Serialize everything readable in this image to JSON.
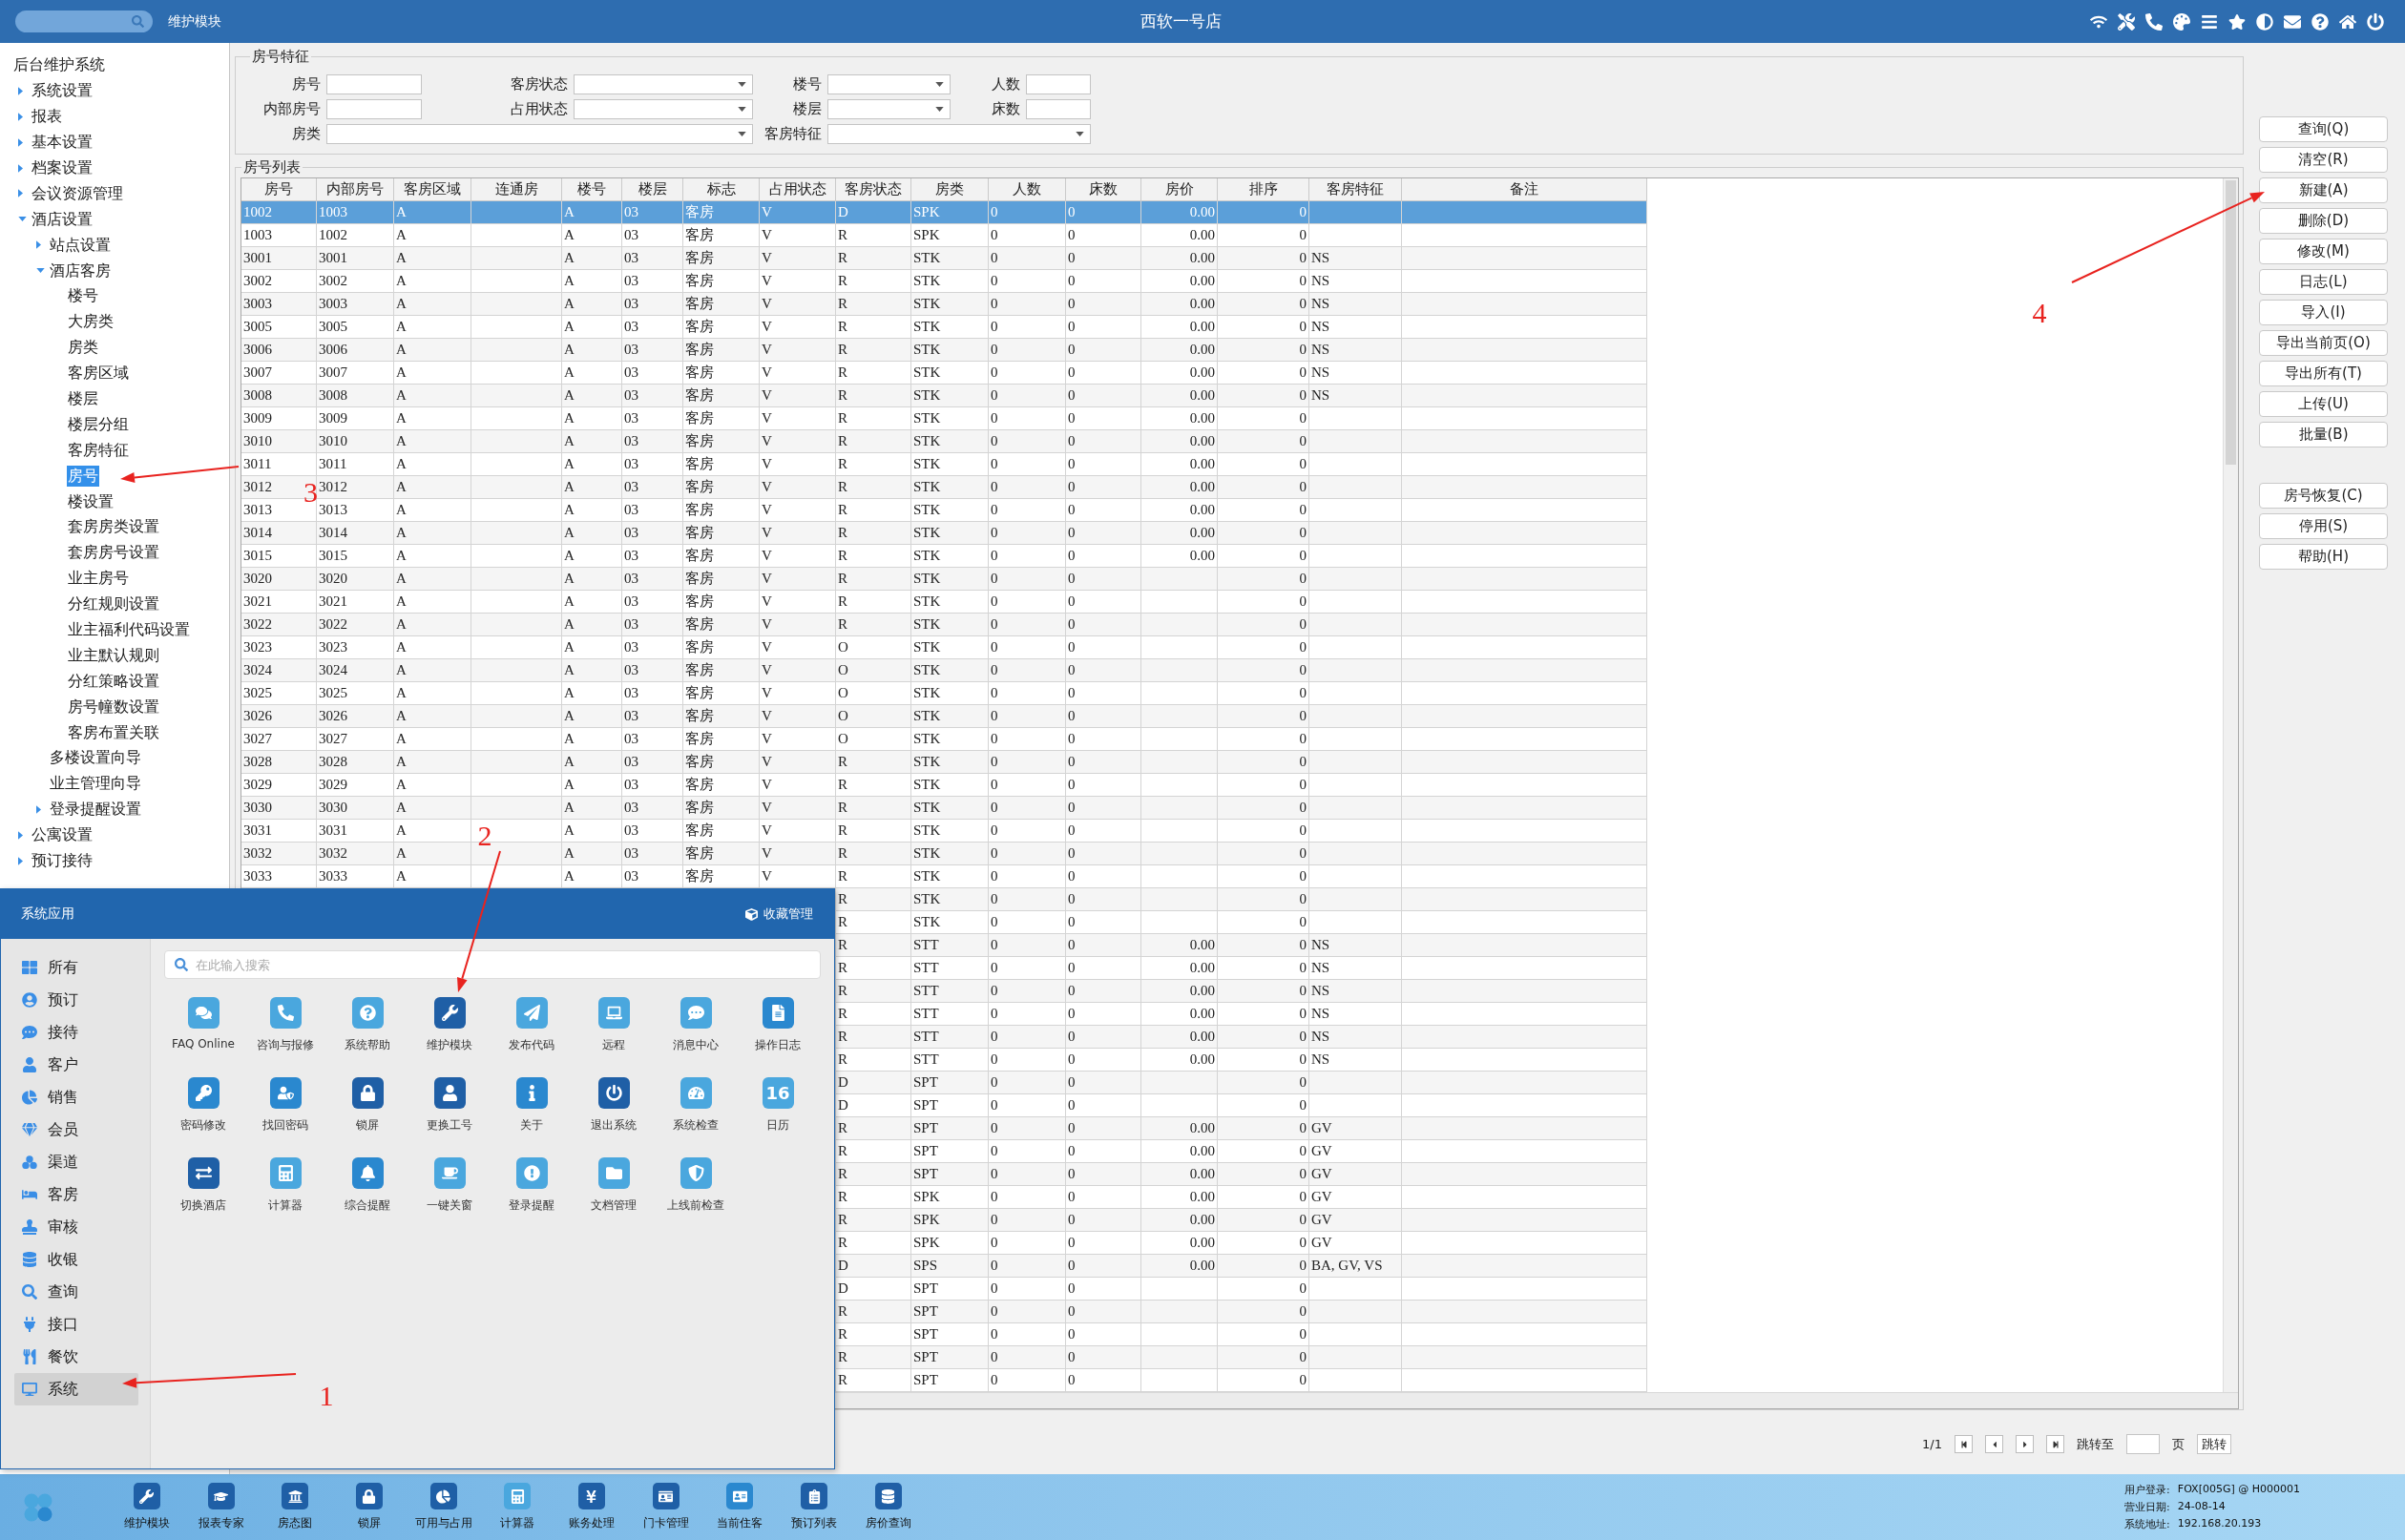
{
  "window": {
    "title": "西软一号店",
    "module": "维护模块"
  },
  "tree": [
    {
      "label": "后台维护系统",
      "selected": false,
      "children": [
        {
          "label": "系统设置",
          "expanded": false,
          "selected": false
        },
        {
          "label": "报表",
          "expanded": false,
          "selected": false
        },
        {
          "label": "基本设置",
          "expanded": false,
          "selected": false
        },
        {
          "label": "档案设置",
          "expanded": false,
          "selected": false
        },
        {
          "label": "会议资源管理",
          "expanded": false,
          "selected": false
        },
        {
          "label": "酒店设置",
          "expanded": true,
          "selected": false,
          "children": [
            {
              "label": "站点设置",
              "expanded": false,
              "selected": false
            },
            {
              "label": "酒店客房",
              "expanded": true,
              "selected": false,
              "children": [
                {
                  "label": "楼号",
                  "selected": false
                },
                {
                  "label": "大房类",
                  "selected": false
                },
                {
                  "label": "房类",
                  "selected": false
                },
                {
                  "label": "客房区域",
                  "selected": false
                },
                {
                  "label": "楼层",
                  "selected": false
                },
                {
                  "label": "楼层分组",
                  "selected": false
                },
                {
                  "label": "客房特征",
                  "selected": false
                },
                {
                  "label": "房号",
                  "selected": true
                },
                {
                  "label": "楼设置",
                  "selected": false
                },
                {
                  "label": "套房房类设置",
                  "selected": false
                },
                {
                  "label": "套房房号设置",
                  "selected": false
                },
                {
                  "label": "业主房号",
                  "selected": false
                },
                {
                  "label": "分红规则设置",
                  "selected": false
                },
                {
                  "label": "业主福利代码设置",
                  "selected": false
                },
                {
                  "label": "业主默认规则",
                  "selected": false
                },
                {
                  "label": "分红策略设置",
                  "selected": false
                },
                {
                  "label": "房号幢数设置",
                  "selected": false
                },
                {
                  "label": "客房布置关联",
                  "selected": false
                }
              ]
            },
            {
              "label": "多楼设置向导",
              "selected": false
            },
            {
              "label": "业主管理向导",
              "selected": false
            },
            {
              "label": "登录提醒设置",
              "expanded": false,
              "selected": false
            }
          ]
        },
        {
          "label": "公寓设置",
          "expanded": false,
          "selected": false
        },
        {
          "label": "预订接待",
          "expanded": false,
          "selected": false
        }
      ]
    }
  ],
  "filter": {
    "title": "房号特征",
    "rows": [
      {
        "fields": [
          {
            "label": "房号",
            "kind": "input"
          },
          {
            "label": "客房状态",
            "kind": "select"
          },
          {
            "label": "楼号",
            "kind": "select"
          },
          {
            "label": "人数",
            "kind": "input"
          }
        ]
      },
      {
        "fields": [
          {
            "label": "内部房号",
            "kind": "input"
          },
          {
            "label": "占用状态",
            "kind": "select"
          },
          {
            "label": "楼层",
            "kind": "select"
          },
          {
            "label": "床数",
            "kind": "input"
          }
        ]
      },
      {
        "fields": [
          {
            "label": "房类",
            "kind": "select"
          },
          {
            "label": "客房特征",
            "kind": "select"
          }
        ]
      }
    ]
  },
  "table": {
    "title": "房号列表",
    "columns": [
      "房号",
      "内部房号",
      "客房区域",
      "连通房",
      "楼号",
      "楼层",
      "标志",
      "占用状态",
      "客房状态",
      "房类",
      "人数",
      "床数",
      "房价",
      "排序",
      "客房特征",
      "备注"
    ],
    "rows": [
      {
        "selected": true,
        "room": "1002",
        "internal": "1003",
        "area": "A",
        "building": "A",
        "floor": "03",
        "flag": "客房",
        "occupancy": "V",
        "status": "D",
        "type": "SPK",
        "persons": "0",
        "beds": "0",
        "price": "0.00",
        "sort": "0"
      },
      {
        "selected": false,
        "room": "1003",
        "internal": "1002",
        "area": "A",
        "building": "A",
        "floor": "03",
        "flag": "客房",
        "occupancy": "V",
        "status": "R",
        "type": "SPK",
        "persons": "0",
        "beds": "0",
        "price": "0.00",
        "sort": "0"
      },
      {
        "selected": false,
        "room": "3001",
        "internal": "3001",
        "area": "A",
        "building": "A",
        "floor": "03",
        "flag": "客房",
        "occupancy": "V",
        "status": "R",
        "type": "STK",
        "persons": "0",
        "beds": "0",
        "price": "0.00",
        "sort": "0",
        "features": "NS"
      },
      {
        "selected": false,
        "room": "3002",
        "internal": "3002",
        "area": "A",
        "building": "A",
        "floor": "03",
        "flag": "客房",
        "occupancy": "V",
        "status": "R",
        "type": "STK",
        "persons": "0",
        "beds": "0",
        "price": "0.00",
        "sort": "0",
        "features": "NS"
      },
      {
        "selected": false,
        "room": "3003",
        "internal": "3003",
        "area": "A",
        "building": "A",
        "floor": "03",
        "flag": "客房",
        "occupancy": "V",
        "status": "R",
        "type": "STK",
        "persons": "0",
        "beds": "0",
        "price": "0.00",
        "sort": "0",
        "features": "NS"
      },
      {
        "selected": false,
        "room": "3005",
        "internal": "3005",
        "area": "A",
        "building": "A",
        "floor": "03",
        "flag": "客房",
        "occupancy": "V",
        "status": "R",
        "type": "STK",
        "persons": "0",
        "beds": "0",
        "price": "0.00",
        "sort": "0",
        "features": "NS"
      },
      {
        "selected": false,
        "room": "3006",
        "internal": "3006",
        "area": "A",
        "building": "A",
        "floor": "03",
        "flag": "客房",
        "occupancy": "V",
        "status": "R",
        "type": "STK",
        "persons": "0",
        "beds": "0",
        "price": "0.00",
        "sort": "0",
        "features": "NS"
      },
      {
        "selected": false,
        "room": "3007",
        "internal": "3007",
        "area": "A",
        "building": "A",
        "floor": "03",
        "flag": "客房",
        "occupancy": "V",
        "status": "R",
        "type": "STK",
        "persons": "0",
        "beds": "0",
        "price": "0.00",
        "sort": "0",
        "features": "NS"
      },
      {
        "selected": false,
        "room": "3008",
        "internal": "3008",
        "area": "A",
        "building": "A",
        "floor": "03",
        "flag": "客房",
        "occupancy": "V",
        "status": "R",
        "type": "STK",
        "persons": "0",
        "beds": "0",
        "price": "0.00",
        "sort": "0",
        "features": "NS"
      },
      {
        "selected": false,
        "room": "3009",
        "internal": "3009",
        "area": "A",
        "building": "A",
        "floor": "03",
        "flag": "客房",
        "occupancy": "V",
        "status": "R",
        "type": "STK",
        "persons": "0",
        "beds": "0",
        "price": "0.00",
        "sort": "0"
      },
      {
        "selected": false,
        "room": "3010",
        "internal": "3010",
        "area": "A",
        "building": "A",
        "floor": "03",
        "flag": "客房",
        "occupancy": "V",
        "status": "R",
        "type": "STK",
        "persons": "0",
        "beds": "0",
        "price": "0.00",
        "sort": "0"
      },
      {
        "selected": false,
        "room": "3011",
        "internal": "3011",
        "area": "A",
        "building": "A",
        "floor": "03",
        "flag": "客房",
        "occupancy": "V",
        "status": "R",
        "type": "STK",
        "persons": "0",
        "beds": "0",
        "price": "0.00",
        "sort": "0"
      },
      {
        "selected": false,
        "room": "3012",
        "internal": "3012",
        "area": "A",
        "building": "A",
        "floor": "03",
        "flag": "客房",
        "occupancy": "V",
        "status": "R",
        "type": "STK",
        "persons": "0",
        "beds": "0",
        "price": "0.00",
        "sort": "0"
      },
      {
        "selected": false,
        "room": "3013",
        "internal": "3013",
        "area": "A",
        "building": "A",
        "floor": "03",
        "flag": "客房",
        "occupancy": "V",
        "status": "R",
        "type": "STK",
        "persons": "0",
        "beds": "0",
        "price": "0.00",
        "sort": "0"
      },
      {
        "selected": false,
        "room": "3014",
        "internal": "3014",
        "area": "A",
        "building": "A",
        "floor": "03",
        "flag": "客房",
        "occupancy": "V",
        "status": "R",
        "type": "STK",
        "persons": "0",
        "beds": "0",
        "price": "0.00",
        "sort": "0"
      },
      {
        "selected": false,
        "room": "3015",
        "internal": "3015",
        "area": "A",
        "building": "A",
        "floor": "03",
        "flag": "客房",
        "occupancy": "V",
        "status": "R",
        "type": "STK",
        "persons": "0",
        "beds": "0",
        "price": "0.00",
        "sort": "0"
      },
      {
        "selected": false,
        "room": "3020",
        "internal": "3020",
        "area": "A",
        "building": "A",
        "floor": "03",
        "flag": "客房",
        "occupancy": "V",
        "status": "R",
        "type": "STK",
        "persons": "0",
        "beds": "0",
        "sort": "0"
      },
      {
        "selected": false,
        "room": "3021",
        "internal": "3021",
        "area": "A",
        "building": "A",
        "floor": "03",
        "flag": "客房",
        "occupancy": "V",
        "status": "R",
        "type": "STK",
        "persons": "0",
        "beds": "0",
        "sort": "0"
      },
      {
        "selected": false,
        "room": "3022",
        "internal": "3022",
        "area": "A",
        "building": "A",
        "floor": "03",
        "flag": "客房",
        "occupancy": "V",
        "status": "R",
        "type": "STK",
        "persons": "0",
        "beds": "0",
        "sort": "0"
      },
      {
        "selected": false,
        "room": "3023",
        "internal": "3023",
        "area": "A",
        "building": "A",
        "floor": "03",
        "flag": "客房",
        "occupancy": "V",
        "status": "O",
        "type": "STK",
        "persons": "0",
        "beds": "0",
        "sort": "0"
      },
      {
        "selected": false,
        "room": "3024",
        "internal": "3024",
        "area": "A",
        "building": "A",
        "floor": "03",
        "flag": "客房",
        "occupancy": "V",
        "status": "O",
        "type": "STK",
        "persons": "0",
        "beds": "0",
        "sort": "0"
      },
      {
        "selected": false,
        "room": "3025",
        "internal": "3025",
        "area": "A",
        "building": "A",
        "floor": "03",
        "flag": "客房",
        "occupancy": "V",
        "status": "O",
        "type": "STK",
        "persons": "0",
        "beds": "0",
        "sort": "0"
      },
      {
        "selected": false,
        "room": "3026",
        "internal": "3026",
        "area": "A",
        "building": "A",
        "floor": "03",
        "flag": "客房",
        "occupancy": "V",
        "status": "O",
        "type": "STK",
        "persons": "0",
        "beds": "0",
        "sort": "0"
      },
      {
        "selected": false,
        "room": "3027",
        "internal": "3027",
        "area": "A",
        "building": "A",
        "floor": "03",
        "flag": "客房",
        "occupancy": "V",
        "status": "O",
        "type": "STK",
        "persons": "0",
        "beds": "0",
        "sort": "0"
      },
      {
        "selected": false,
        "room": "3028",
        "internal": "3028",
        "area": "A",
        "building": "A",
        "floor": "03",
        "flag": "客房",
        "occupancy": "V",
        "status": "R",
        "type": "STK",
        "persons": "0",
        "beds": "0",
        "sort": "0"
      },
      {
        "selected": false,
        "room": "3029",
        "internal": "3029",
        "area": "A",
        "building": "A",
        "floor": "03",
        "flag": "客房",
        "occupancy": "V",
        "status": "R",
        "type": "STK",
        "persons": "0",
        "beds": "0",
        "sort": "0"
      },
      {
        "selected": false,
        "room": "3030",
        "internal": "3030",
        "area": "A",
        "building": "A",
        "floor": "03",
        "flag": "客房",
        "occupancy": "V",
        "status": "R",
        "type": "STK",
        "persons": "0",
        "beds": "0",
        "sort": "0"
      },
      {
        "selected": false,
        "room": "3031",
        "internal": "3031",
        "area": "A",
        "building": "A",
        "floor": "03",
        "flag": "客房",
        "occupancy": "V",
        "status": "R",
        "type": "STK",
        "persons": "0",
        "beds": "0",
        "sort": "0"
      },
      {
        "selected": false,
        "room": "3032",
        "internal": "3032",
        "area": "A",
        "building": "A",
        "floor": "03",
        "flag": "客房",
        "occupancy": "V",
        "status": "R",
        "type": "STK",
        "persons": "0",
        "beds": "0",
        "sort": "0"
      },
      {
        "selected": false,
        "room": "3033",
        "internal": "3033",
        "area": "A",
        "building": "A",
        "floor": "03",
        "flag": "客房",
        "occupancy": "V",
        "status": "R",
        "type": "STK",
        "persons": "0",
        "beds": "0",
        "sort": "0"
      },
      {
        "selected": false,
        "status": "R",
        "type": "STK",
        "persons": "0",
        "beds": "0",
        "sort": "0"
      },
      {
        "selected": false,
        "status": "R",
        "type": "STK",
        "persons": "0",
        "beds": "0",
        "sort": "0"
      },
      {
        "selected": false,
        "status": "R",
        "type": "STT",
        "persons": "0",
        "beds": "0",
        "price": "0.00",
        "sort": "0",
        "features": "NS"
      },
      {
        "selected": false,
        "status": "R",
        "type": "STT",
        "persons": "0",
        "beds": "0",
        "price": "0.00",
        "sort": "0",
        "features": "NS"
      },
      {
        "selected": false,
        "status": "R",
        "type": "STT",
        "persons": "0",
        "beds": "0",
        "price": "0.00",
        "sort": "0",
        "features": "NS"
      },
      {
        "selected": false,
        "status": "R",
        "type": "STT",
        "persons": "0",
        "beds": "0",
        "price": "0.00",
        "sort": "0",
        "features": "NS"
      },
      {
        "selected": false,
        "status": "R",
        "type": "STT",
        "persons": "0",
        "beds": "0",
        "price": "0.00",
        "sort": "0",
        "features": "NS"
      },
      {
        "selected": false,
        "status": "R",
        "type": "STT",
        "persons": "0",
        "beds": "0",
        "price": "0.00",
        "sort": "0",
        "features": "NS"
      },
      {
        "selected": false,
        "status": "D",
        "type": "SPT",
        "persons": "0",
        "beds": "0",
        "sort": "0"
      },
      {
        "selected": false,
        "status": "D",
        "type": "SPT",
        "persons": "0",
        "beds": "0",
        "sort": "0"
      },
      {
        "selected": false,
        "status": "R",
        "type": "SPT",
        "persons": "0",
        "beds": "0",
        "price": "0.00",
        "sort": "0",
        "features": "GV"
      },
      {
        "selected": false,
        "status": "R",
        "type": "SPT",
        "persons": "0",
        "beds": "0",
        "price": "0.00",
        "sort": "0",
        "features": "GV"
      },
      {
        "selected": false,
        "status": "R",
        "type": "SPT",
        "persons": "0",
        "beds": "0",
        "price": "0.00",
        "sort": "0",
        "features": "GV"
      },
      {
        "selected": false,
        "status": "R",
        "type": "SPK",
        "persons": "0",
        "beds": "0",
        "price": "0.00",
        "sort": "0",
        "features": "GV"
      },
      {
        "selected": false,
        "status": "R",
        "type": "SPK",
        "persons": "0",
        "beds": "0",
        "price": "0.00",
        "sort": "0",
        "features": "GV"
      },
      {
        "selected": false,
        "status": "R",
        "type": "SPK",
        "persons": "0",
        "beds": "0",
        "price": "0.00",
        "sort": "0",
        "features": "GV"
      },
      {
        "selected": false,
        "status": "D",
        "type": "SPS",
        "persons": "0",
        "beds": "0",
        "price": "0.00",
        "sort": "0",
        "features": "BA, GV, VS"
      },
      {
        "selected": false,
        "status": "D",
        "type": "SPT",
        "persons": "0",
        "beds": "0",
        "sort": "0"
      },
      {
        "selected": false,
        "status": "R",
        "type": "SPT",
        "persons": "0",
        "beds": "0",
        "sort": "0"
      },
      {
        "selected": false,
        "status": "R",
        "type": "SPT",
        "persons": "0",
        "beds": "0",
        "sort": "0"
      },
      {
        "selected": false,
        "status": "R",
        "type": "SPT",
        "persons": "0",
        "beds": "0",
        "sort": "0"
      },
      {
        "selected": false,
        "status": "R",
        "type": "SPT",
        "persons": "0",
        "beds": "0",
        "sort": "0"
      }
    ]
  },
  "pager": {
    "page": "1/1",
    "jump_label": "跳转至",
    "unit": "页",
    "go": "跳转"
  },
  "actions": [
    {
      "buttons": [
        "查询(Q)",
        "清空(R)",
        "新建(A)",
        "删除(D)",
        "修改(M)",
        "日志(L)",
        "导入(I)",
        "导出当前页(O)",
        "导出所有(T)",
        "上传(U)",
        "批量(B)"
      ]
    },
    {
      "buttons": [
        "房号恢复(C)",
        "停用(S)",
        "帮助(H)"
      ]
    }
  ],
  "app_panel": {
    "title": "系统应用",
    "favorites": "收藏管理",
    "categories": [
      {
        "label": "所有",
        "selected": false
      },
      {
        "label": "预订",
        "selected": false
      },
      {
        "label": "接待",
        "selected": false
      },
      {
        "label": "客户",
        "selected": false
      },
      {
        "label": "销售",
        "selected": false
      },
      {
        "label": "会员",
        "selected": false
      },
      {
        "label": "渠道",
        "selected": false
      },
      {
        "label": "客房",
        "selected": false
      },
      {
        "label": "审核",
        "selected": false
      },
      {
        "label": "收银",
        "selected": false
      },
      {
        "label": "查询",
        "selected": false
      },
      {
        "label": "接口",
        "selected": false
      },
      {
        "label": "餐饮",
        "selected": false
      },
      {
        "label": "系统",
        "selected": true
      }
    ],
    "search": {
      "placeholder": "在此输入搜索"
    },
    "apps": [
      {
        "label": "FAQ Online"
      },
      {
        "label": "咨询与报修"
      },
      {
        "label": "系统帮助"
      },
      {
        "label": "维护模块"
      },
      {
        "label": "发布代码"
      },
      {
        "label": "远程"
      },
      {
        "label": "消息中心"
      },
      {
        "label": "操作日志"
      },
      {
        "label": "密码修改"
      },
      {
        "label": "找回密码"
      },
      {
        "label": "锁屏"
      },
      {
        "label": "更换工号"
      },
      {
        "label": "关于"
      },
      {
        "label": "退出系统"
      },
      {
        "label": "系统检查"
      },
      {
        "label": "日历",
        "icon_text": "16"
      },
      {
        "label": "切换酒店"
      },
      {
        "label": "计算器"
      },
      {
        "label": "综合提醒"
      },
      {
        "label": "一键关窗"
      },
      {
        "label": "登录提醒"
      },
      {
        "label": "文档管理"
      },
      {
        "label": "上线前检查"
      }
    ]
  },
  "taskbar": {
    "items": [
      "维护模块",
      "报表专家",
      "房态图",
      "锁屏",
      "可用与占用",
      "计算器",
      "账务处理",
      "门卡管理",
      "当前住客",
      "预订列表",
      "房价查询"
    ],
    "info": [
      {
        "label": "用户登录:",
        "value": "FOX[005G] @ H000001"
      },
      {
        "label": "营业日期:",
        "value": "24-08-14"
      },
      {
        "label": "系统地址:",
        "value": "192.168.20.193"
      }
    ]
  },
  "annotations": [
    {
      "label": "1"
    },
    {
      "label": "2"
    },
    {
      "label": "3"
    },
    {
      "label": "4"
    }
  ]
}
